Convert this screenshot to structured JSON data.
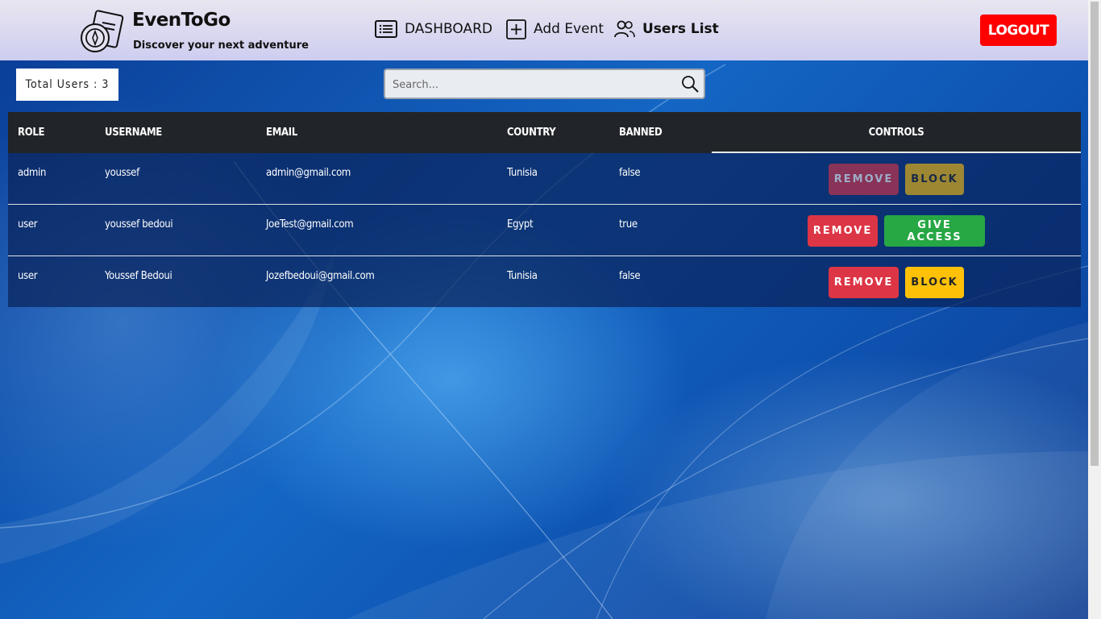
{
  "brand": {
    "title": "EvenToGo",
    "subtitle": "Discover your next adventure"
  },
  "nav": {
    "dashboard": "DASHBOARD",
    "add_event": "Add Event",
    "users_list": "Users List"
  },
  "logout_label": "LOGOUT",
  "total_users_label": "Total Users : 3",
  "search": {
    "placeholder": "Search..."
  },
  "table": {
    "headers": {
      "role": "ROLE",
      "username": "USERNAME",
      "email": "EMAIL",
      "country": "COUNTRY",
      "banned": "BANNED",
      "controls": "CONTROLS"
    },
    "rows": [
      {
        "role": "admin",
        "username": "youssef",
        "email": "admin@gmail.com",
        "country": "Tunisia",
        "banned": "false",
        "remove_label": "REMOVE",
        "action_label": "BLOCK",
        "controls_disabled": true
      },
      {
        "role": "user",
        "username": "youssef bedoui",
        "email": "JoeTest@gmail.com",
        "country": "Egypt",
        "banned": "true",
        "remove_label": "REMOVE",
        "action_label": "GIVE ACCESS",
        "controls_disabled": false
      },
      {
        "role": "user",
        "username": "Youssef Bedoui",
        "email": "Jozefbedoui@gmail.com",
        "country": "Tunisia",
        "banned": "false",
        "remove_label": "REMOVE",
        "action_label": "BLOCK",
        "controls_disabled": false
      }
    ]
  },
  "colors": {
    "remove": "#dc3545",
    "block": "#ffc107",
    "give_access": "#28a745",
    "logout": "#ff0000",
    "table_header": "#212529"
  }
}
